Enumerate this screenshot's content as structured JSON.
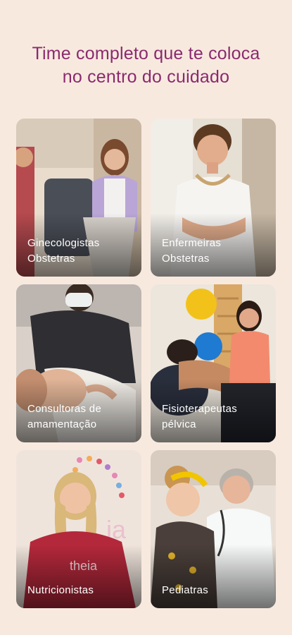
{
  "headline": "Time completo que te coloca\nno centro do cuidado",
  "cards": [
    {
      "label": "Ginecologistas\nObstetras"
    },
    {
      "label": "Enfermeiras\nObstetras"
    },
    {
      "label": "Consultoras de\namamentação"
    },
    {
      "label": "Fisioterapeutas\npélvica"
    },
    {
      "label": "Nutricionistas"
    },
    {
      "label": "Pediatras"
    }
  ],
  "colors": {
    "background": "#f8e9df",
    "headline": "#8a2a6e",
    "label": "#ffffff"
  }
}
